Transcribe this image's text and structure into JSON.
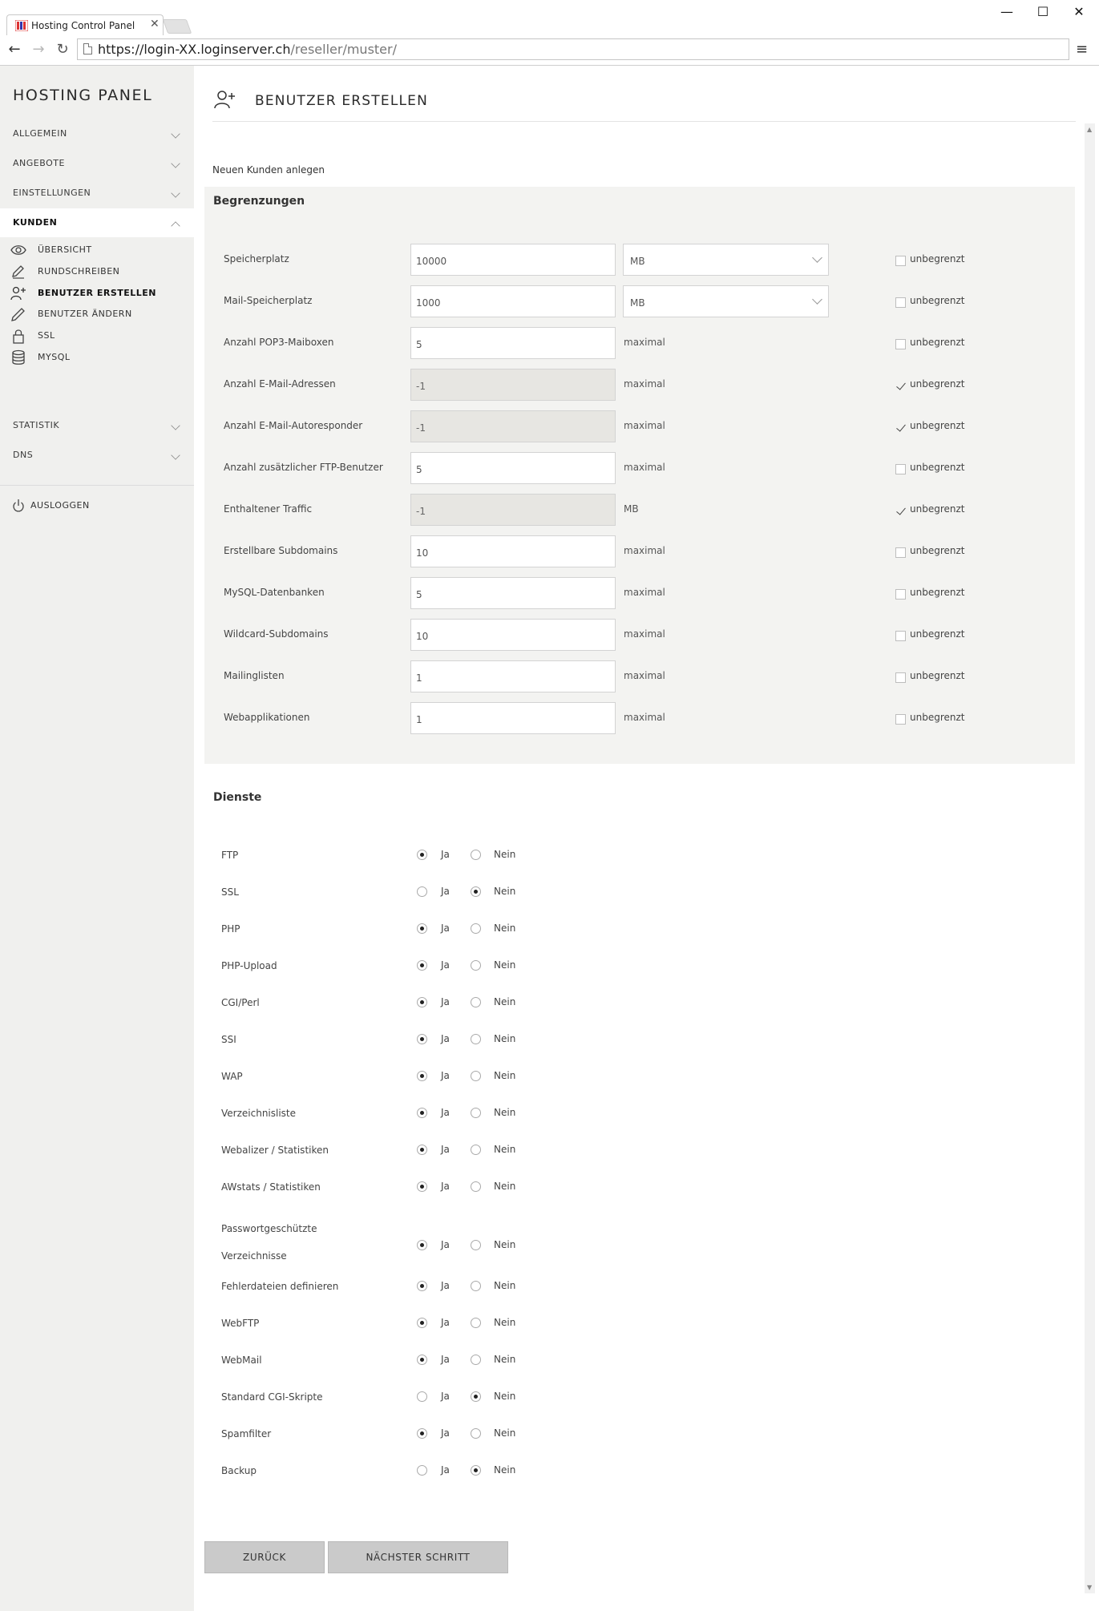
{
  "browser": {
    "tab_title": "Hosting Control Panel",
    "tab_close": "✕",
    "url_host": "https://login-XX.loginserver.ch",
    "url_path": "/reseller/muster/",
    "buttons": {
      "minimize": "—",
      "maximize": "☐",
      "close": "✕"
    }
  },
  "sidebar": {
    "brand": "HOSTING PANEL",
    "groups": [
      {
        "label": "ALLGEMEIN"
      },
      {
        "label": "ANGEBOTE"
      },
      {
        "label": "EINSTELLUNGEN"
      },
      {
        "label": "KUNDEN",
        "open": true
      },
      {
        "label": "STATISTIK"
      },
      {
        "label": "DNS"
      }
    ],
    "sub_items": [
      {
        "label": "ÜBERSICHT",
        "icon": "eye-icon"
      },
      {
        "label": "RUNDSCHREIBEN",
        "icon": "edit-icon"
      },
      {
        "label": "BENUTZER ERSTELLEN",
        "icon": "add-user-icon",
        "active": true
      },
      {
        "label": "BENUTZER ÄNDERN",
        "icon": "pencil-icon"
      },
      {
        "label": "SSL",
        "icon": "lock-icon"
      },
      {
        "label": "MYSQL",
        "icon": "database-icon"
      }
    ],
    "logout": "AUSLOGGEN"
  },
  "header": {
    "title": "BENUTZER ERSTELLEN",
    "icon": "add-user-icon"
  },
  "form": {
    "intro": "Neuen Kunden anlegen",
    "limits_title": "Begrenzungen",
    "unlimited_label": "unbegrenzt",
    "limits": [
      {
        "label": "Speicherplatz",
        "value": "10000",
        "unit": "MB",
        "unit_select": true,
        "unlimited": false,
        "disabled": false
      },
      {
        "label": "Mail-Speicherplatz",
        "value": "1000",
        "unit": "MB",
        "unit_select": true,
        "unlimited": false,
        "disabled": false
      },
      {
        "label": "Anzahl POP3-Maiboxen",
        "value": "5",
        "unit": "maximal",
        "unlimited": false,
        "disabled": false
      },
      {
        "label": "Anzahl E-Mail-Adressen",
        "value": "-1",
        "unit": "maximal",
        "unlimited": true,
        "disabled": true
      },
      {
        "label": "Anzahl E-Mail-Autoresponder",
        "value": "-1",
        "unit": "maximal",
        "unlimited": true,
        "disabled": true
      },
      {
        "label": "Anzahl zusätzlicher FTP-Benutzer",
        "value": "5",
        "unit": "maximal",
        "unlimited": false,
        "disabled": false
      },
      {
        "label": "Enthaltener Traffic",
        "value": "-1",
        "unit": "MB",
        "unlimited": true,
        "disabled": true
      },
      {
        "label": "Erstellbare Subdomains",
        "value": "10",
        "unit": "maximal",
        "unlimited": false,
        "disabled": false
      },
      {
        "label": "MySQL-Datenbanken",
        "value": "5",
        "unit": "maximal",
        "unlimited": false,
        "disabled": false
      },
      {
        "label": "Wildcard-Subdomains",
        "value": "10",
        "unit": "maximal",
        "unlimited": false,
        "disabled": false
      },
      {
        "label": "Mailinglisten",
        "value": "1",
        "unit": "maximal",
        "unlimited": false,
        "disabled": false
      },
      {
        "label": "Webapplikationen",
        "value": "1",
        "unit": "maximal",
        "unlimited": false,
        "disabled": false
      }
    ],
    "services_title": "Dienste",
    "yes_label": "Ja",
    "no_label": "Nein",
    "services": [
      {
        "label": "FTP",
        "enabled": true
      },
      {
        "label": "SSL",
        "enabled": false
      },
      {
        "label": "PHP",
        "enabled": true
      },
      {
        "label": "PHP-Upload",
        "enabled": true
      },
      {
        "label": "CGI/Perl",
        "enabled": true
      },
      {
        "label": "SSI",
        "enabled": true
      },
      {
        "label": "WAP",
        "enabled": true
      },
      {
        "label": "Verzeichnisliste",
        "enabled": true
      },
      {
        "label": "Webalizer / Statistiken",
        "enabled": true
      },
      {
        "label": "AWstats / Statistiken",
        "enabled": true
      },
      {
        "label": "Passwortgeschützte Verzeichnisse",
        "enabled": true
      },
      {
        "label": "Fehlerdateien definieren",
        "enabled": true
      },
      {
        "label": "WebFTP",
        "enabled": true
      },
      {
        "label": "WebMail",
        "enabled": true
      },
      {
        "label": "Standard CGI-Skripte",
        "enabled": false
      },
      {
        "label": "Spamfilter",
        "enabled": true
      },
      {
        "label": "Backup",
        "enabled": false
      }
    ],
    "back_button": "ZURÜCK",
    "next_button": "NÄCHSTER SCHRITT"
  }
}
